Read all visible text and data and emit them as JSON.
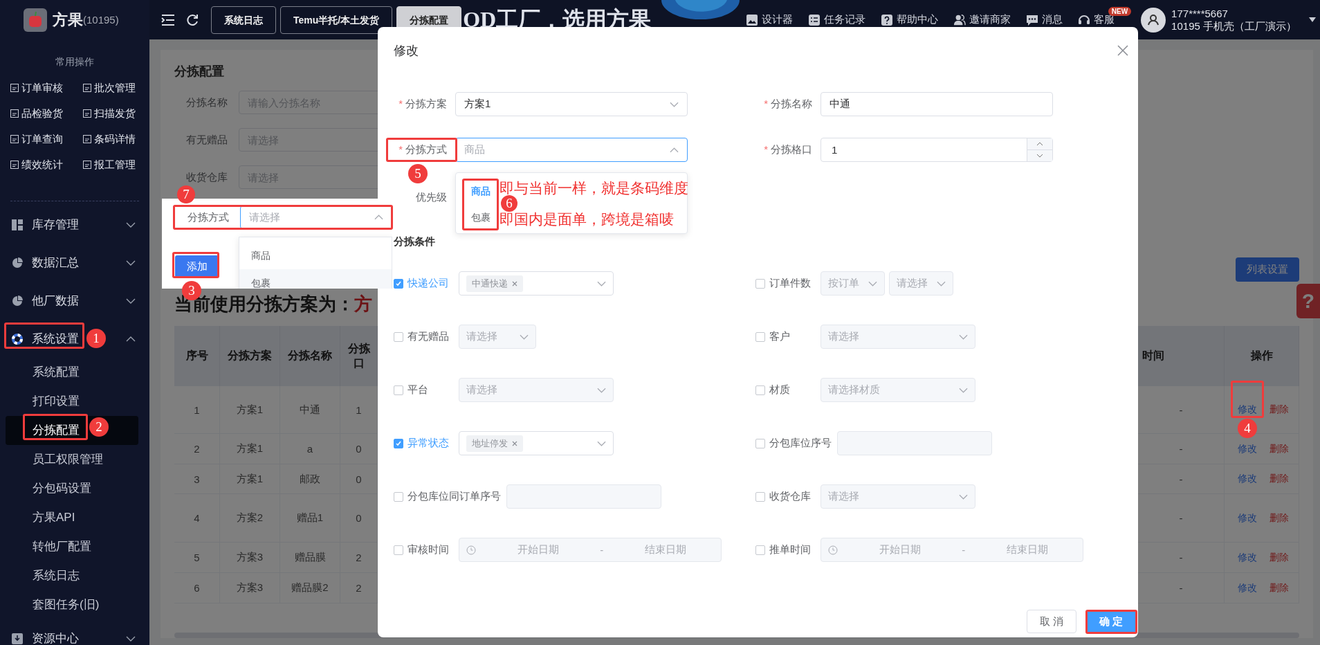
{
  "sidebar": {
    "logo": {
      "name": "方果",
      "code": "(10195)"
    },
    "section_title": "常用操作",
    "quick_actions": [
      {
        "label": "订单审核"
      },
      {
        "label": "批次管理"
      },
      {
        "label": "品检验货"
      },
      {
        "label": "扫描发货"
      },
      {
        "label": "订单查询"
      },
      {
        "label": "条码详情"
      },
      {
        "label": "绩效统计"
      },
      {
        "label": "报工管理"
      }
    ],
    "menu": [
      {
        "label": "库存管理",
        "expanded": false
      },
      {
        "label": "数据汇总",
        "expanded": false
      },
      {
        "label": "他厂数据",
        "expanded": false
      },
      {
        "label": "系统设置",
        "expanded": true,
        "children": [
          {
            "label": "系统配置",
            "selected": false
          },
          {
            "label": "打印设置",
            "selected": false
          },
          {
            "label": "分拣配置",
            "selected": true
          },
          {
            "label": "员工权限管理",
            "selected": false
          },
          {
            "label": "分包码设置",
            "selected": false
          },
          {
            "label": "方果API",
            "selected": false
          },
          {
            "label": "转他厂配置",
            "selected": false
          },
          {
            "label": "系统日志",
            "selected": false
          },
          {
            "label": "套图任务(旧)",
            "selected": false
          }
        ]
      },
      {
        "label": "资源中心",
        "expanded": false
      }
    ]
  },
  "topbar": {
    "tabs": [
      {
        "label": "系统日志",
        "selected": false
      },
      {
        "label": "Temu半托/本土发货",
        "selected": false
      },
      {
        "label": "分拣配置",
        "selected": true
      }
    ],
    "banner_text": "OD工厂，选用方果",
    "tools": [
      {
        "label": "设计器"
      },
      {
        "label": "任务记录"
      },
      {
        "label": "帮助中心"
      },
      {
        "label": "邀请商家"
      },
      {
        "label": "消息"
      },
      {
        "label": "客服",
        "badge": "NEW"
      }
    ],
    "user": {
      "phone": "177****5667",
      "company": "10195 手机壳（工厂演示）"
    }
  },
  "page": {
    "title": "分拣配置",
    "filters": [
      {
        "label": "分拣名称",
        "placeholder": "请输入分拣名称"
      },
      {
        "label": "有无赠品",
        "placeholder": "请选择"
      },
      {
        "label": "收货仓库",
        "placeholder": "请选择"
      }
    ],
    "list_settings": "列表设置",
    "plan_heading": "当前使用分拣方案为：",
    "plan_value": "方",
    "help": "?",
    "table": {
      "columns": [
        "序号",
        "分拣方案",
        "分拣名称",
        "分拣口"
      ],
      "right_columns": [
        "时间",
        "操作"
      ],
      "rows": [
        {
          "cells": [
            "1",
            "方案1",
            "中通",
            "1"
          ],
          "time": "-",
          "actions": [
            "修改",
            "删除"
          ]
        },
        {
          "cells": [
            "2",
            "方案1",
            "a",
            "0"
          ],
          "time": "-",
          "actions": [
            "修改",
            "删除"
          ]
        },
        {
          "cells": [
            "3",
            "方案1",
            "邮政",
            "0"
          ],
          "time": "-",
          "actions": [
            "修改",
            "删除"
          ]
        },
        {
          "cells": [
            "4",
            "方案2",
            "赠品1",
            "0"
          ],
          "time": "-",
          "actions": [
            "修改",
            "删除"
          ]
        },
        {
          "cells": [
            "5",
            "方案3",
            "赠品膜",
            "2"
          ],
          "time": "-",
          "actions": [
            "修改",
            "删除"
          ]
        },
        {
          "cells": [
            "6",
            "方案3",
            "赠品膜2",
            "2"
          ],
          "time": "-",
          "actions": [
            "修改",
            "删除"
          ]
        }
      ]
    }
  },
  "popup": {
    "label": "分拣方式",
    "placeholder": "请选择",
    "open": true,
    "options": [
      {
        "label": "商品",
        "hovered": false
      },
      {
        "label": "包裹",
        "hovered": true
      }
    ],
    "button": "添加"
  },
  "modal": {
    "title": "修改",
    "fields": [
      {
        "mark": "*",
        "label": "分拣方案",
        "kind": "select",
        "value": "方案1",
        "open": false
      },
      {
        "mark": "*",
        "label": "分拣名称",
        "kind": "input",
        "value": "中通"
      },
      {
        "mark": "*",
        "label": "分拣方式",
        "kind": "select",
        "value": "商品",
        "open": true
      },
      {
        "mark": "*",
        "label": "分拣格口",
        "kind": "number",
        "value": "1"
      }
    ],
    "priority_label": "优先级",
    "dropdown": {
      "options": [
        {
          "label": "商品",
          "selected": true
        },
        {
          "label": "包裹",
          "selected": false
        }
      ]
    },
    "notes": [
      "即与当前一样，就是条码维度",
      "即国内是面单，跨境是箱唛"
    ],
    "conditions_title": "分拣条件",
    "conditions": [
      {
        "label": "快递公司",
        "checked": true,
        "controls": [
          {
            "kind": "tags",
            "tags": [
              "中通快递"
            ]
          }
        ]
      },
      {
        "label": "订单件数",
        "checked": false,
        "controls": [
          {
            "kind": "select",
            "value": "按订单"
          },
          {
            "kind": "select",
            "placeholder": "请选择"
          }
        ]
      },
      {
        "label": "有无赠品",
        "checked": false,
        "controls": [
          {
            "kind": "select",
            "placeholder": "请选择"
          }
        ]
      },
      {
        "label": "客户",
        "checked": false,
        "controls": [
          {
            "kind": "select",
            "placeholder": "请选择"
          }
        ]
      },
      {
        "label": "平台",
        "checked": false,
        "controls": [
          {
            "kind": "select",
            "placeholder": "请选择"
          }
        ]
      },
      {
        "label": "材质",
        "checked": false,
        "controls": [
          {
            "kind": "select",
            "placeholder": "请选择材质"
          }
        ]
      },
      {
        "label": "异常状态",
        "checked": true,
        "controls": [
          {
            "kind": "tags",
            "tags": [
              "地址停发"
            ]
          }
        ]
      },
      {
        "label": "分包库位序号",
        "checked": false,
        "controls": [
          {
            "kind": "input"
          }
        ]
      },
      {
        "label": "分包库位同订单序号",
        "checked": false,
        "controls": [
          {
            "kind": "input"
          }
        ]
      },
      {
        "label": "收货仓库",
        "checked": false,
        "controls": [
          {
            "kind": "select",
            "placeholder": "请选择"
          }
        ]
      },
      {
        "label": "审核时间",
        "checked": false,
        "controls": [
          {
            "kind": "daterange",
            "start": "开始日期",
            "separator": "-",
            "end": "结束日期"
          }
        ]
      },
      {
        "label": "推单时间",
        "checked": false,
        "controls": [
          {
            "kind": "daterange",
            "start": "开始日期",
            "separator": "-",
            "end": "结束日期"
          }
        ]
      }
    ],
    "buttons": [
      {
        "label": "取 消",
        "kind": "secondary"
      },
      {
        "label": "确 定",
        "kind": "primary"
      }
    ]
  },
  "annotations": [
    {
      "number": "1"
    },
    {
      "number": "2"
    },
    {
      "number": "3"
    },
    {
      "number": "4"
    },
    {
      "number": "5"
    },
    {
      "number": "6"
    },
    {
      "number": "7"
    }
  ]
}
